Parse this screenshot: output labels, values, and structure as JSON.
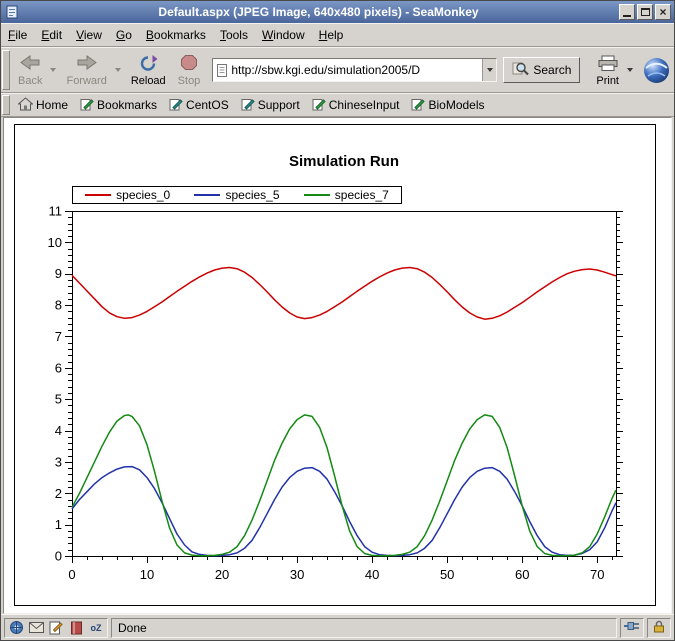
{
  "window": {
    "title": "Default.aspx (JPEG Image, 640x480 pixels) - SeaMonkey"
  },
  "menu": {
    "items": [
      "File",
      "Edit",
      "View",
      "Go",
      "Bookmarks",
      "Tools",
      "Window",
      "Help"
    ]
  },
  "toolbar": {
    "back_label": "Back",
    "forward_label": "Forward",
    "reload_label": "Reload",
    "stop_label": "Stop",
    "url_value": "http://sbw.kgi.edu/simulation2005/D",
    "search_label": "Search",
    "print_label": "Print"
  },
  "personal_bar": {
    "items": [
      "Home",
      "Bookmarks",
      "CentOS",
      "Support",
      "ChineseInput",
      "BioModels"
    ]
  },
  "status_bar": {
    "text": "Done",
    "component_icons": [
      "navigator",
      "mail-news",
      "composer",
      "address-book",
      "chatzilla"
    ],
    "chatzilla_label": "oZ",
    "right_icons": [
      "online-plug",
      "security-lock"
    ]
  },
  "chart_data": {
    "type": "line",
    "title": "Simulation Run",
    "xlabel": "",
    "ylabel": "",
    "xlim": [
      0,
      72.5
    ],
    "ylim": [
      0,
      11
    ],
    "x_major": 10,
    "x_minor": 2,
    "y_major": 1,
    "y_minor": 0.2,
    "grid": false,
    "legend_position": "top-left",
    "series": [
      {
        "name": "species_0",
        "color": "#cc0000",
        "points": [
          [
            0,
            8.95
          ],
          [
            1,
            8.7
          ],
          [
            2,
            8.45
          ],
          [
            3,
            8.2
          ],
          [
            4,
            7.95
          ],
          [
            5,
            7.75
          ],
          [
            6,
            7.63
          ],
          [
            7,
            7.58
          ],
          [
            8,
            7.6
          ],
          [
            9,
            7.68
          ],
          [
            10,
            7.8
          ],
          [
            11,
            7.95
          ],
          [
            12,
            8.1
          ],
          [
            13,
            8.27
          ],
          [
            14,
            8.44
          ],
          [
            15,
            8.6
          ],
          [
            16,
            8.76
          ],
          [
            17,
            8.9
          ],
          [
            18,
            9.02
          ],
          [
            19,
            9.12
          ],
          [
            20,
            9.18
          ],
          [
            21,
            9.2
          ],
          [
            22,
            9.16
          ],
          [
            23,
            9.05
          ],
          [
            24,
            8.88
          ],
          [
            25,
            8.66
          ],
          [
            26,
            8.42
          ],
          [
            27,
            8.17
          ],
          [
            28,
            7.94
          ],
          [
            29,
            7.75
          ],
          [
            30,
            7.62
          ],
          [
            31,
            7.57
          ],
          [
            32,
            7.6
          ],
          [
            33,
            7.68
          ],
          [
            34,
            7.8
          ],
          [
            35,
            7.95
          ],
          [
            36,
            8.1
          ],
          [
            37,
            8.27
          ],
          [
            38,
            8.44
          ],
          [
            39,
            8.6
          ],
          [
            40,
            8.76
          ],
          [
            41,
            8.9
          ],
          [
            42,
            9.02
          ],
          [
            43,
            9.12
          ],
          [
            44,
            9.18
          ],
          [
            45,
            9.2
          ],
          [
            46,
            9.16
          ],
          [
            47,
            9.05
          ],
          [
            48,
            8.88
          ],
          [
            49,
            8.66
          ],
          [
            50,
            8.42
          ],
          [
            51,
            8.17
          ],
          [
            52,
            7.94
          ],
          [
            53,
            7.75
          ],
          [
            54,
            7.62
          ],
          [
            55,
            7.55
          ],
          [
            56,
            7.58
          ],
          [
            57,
            7.66
          ],
          [
            58,
            7.78
          ],
          [
            59,
            7.93
          ],
          [
            60,
            8.08
          ],
          [
            61,
            8.25
          ],
          [
            62,
            8.42
          ],
          [
            63,
            8.58
          ],
          [
            64,
            8.74
          ],
          [
            65,
            8.88
          ],
          [
            66,
            9.0
          ],
          [
            67,
            9.08
          ],
          [
            68,
            9.13
          ],
          [
            69,
            9.15
          ],
          [
            70,
            9.12
          ],
          [
            71,
            9.05
          ],
          [
            72,
            8.97
          ],
          [
            72.5,
            8.93
          ]
        ]
      },
      {
        "name": "species_5",
        "color": "#2233aa",
        "points": [
          [
            0,
            1.5
          ],
          [
            1,
            1.8
          ],
          [
            2,
            2.05
          ],
          [
            3,
            2.3
          ],
          [
            4,
            2.5
          ],
          [
            5,
            2.65
          ],
          [
            6,
            2.77
          ],
          [
            7,
            2.84
          ],
          [
            8,
            2.85
          ],
          [
            9,
            2.75
          ],
          [
            10,
            2.5
          ],
          [
            11,
            2.15
          ],
          [
            12,
            1.7
          ],
          [
            13,
            1.2
          ],
          [
            14,
            0.7
          ],
          [
            15,
            0.35
          ],
          [
            16,
            0.13
          ],
          [
            17,
            0.05
          ],
          [
            18,
            0.02
          ],
          [
            19,
            0.01
          ],
          [
            20,
            0.02
          ],
          [
            21,
            0.04
          ],
          [
            22,
            0.1
          ],
          [
            23,
            0.25
          ],
          [
            24,
            0.5
          ],
          [
            25,
            0.9
          ],
          [
            26,
            1.35
          ],
          [
            27,
            1.8
          ],
          [
            28,
            2.2
          ],
          [
            29,
            2.5
          ],
          [
            30,
            2.7
          ],
          [
            31,
            2.8
          ],
          [
            32,
            2.82
          ],
          [
            33,
            2.7
          ],
          [
            34,
            2.45
          ],
          [
            35,
            2.05
          ],
          [
            36,
            1.6
          ],
          [
            37,
            1.1
          ],
          [
            38,
            0.65
          ],
          [
            39,
            0.3
          ],
          [
            40,
            0.12
          ],
          [
            41,
            0.04
          ],
          [
            42,
            0.02
          ],
          [
            43,
            0.01
          ],
          [
            44,
            0.02
          ],
          [
            45,
            0.04
          ],
          [
            46,
            0.1
          ],
          [
            47,
            0.25
          ],
          [
            48,
            0.5
          ],
          [
            49,
            0.9
          ],
          [
            50,
            1.35
          ],
          [
            51,
            1.8
          ],
          [
            52,
            2.2
          ],
          [
            53,
            2.5
          ],
          [
            54,
            2.7
          ],
          [
            55,
            2.8
          ],
          [
            56,
            2.82
          ],
          [
            57,
            2.7
          ],
          [
            58,
            2.45
          ],
          [
            59,
            2.05
          ],
          [
            60,
            1.6
          ],
          [
            61,
            1.1
          ],
          [
            62,
            0.65
          ],
          [
            63,
            0.3
          ],
          [
            64,
            0.12
          ],
          [
            65,
            0.04
          ],
          [
            66,
            0.02
          ],
          [
            67,
            0.03
          ],
          [
            68,
            0.08
          ],
          [
            69,
            0.2
          ],
          [
            70,
            0.45
          ],
          [
            71,
            0.9
          ],
          [
            72,
            1.45
          ],
          [
            72.5,
            1.7
          ]
        ]
      },
      {
        "name": "species_7",
        "color": "#148a14",
        "points": [
          [
            0,
            1.55
          ],
          [
            1,
            2.0
          ],
          [
            2,
            2.5
          ],
          [
            3,
            3.0
          ],
          [
            4,
            3.5
          ],
          [
            5,
            3.95
          ],
          [
            6,
            4.3
          ],
          [
            7,
            4.48
          ],
          [
            7.5,
            4.5
          ],
          [
            8,
            4.45
          ],
          [
            9,
            4.15
          ],
          [
            10,
            3.55
          ],
          [
            11,
            2.7
          ],
          [
            12,
            1.75
          ],
          [
            13,
            0.9
          ],
          [
            14,
            0.35
          ],
          [
            15,
            0.1
          ],
          [
            16,
            0.03
          ],
          [
            17,
            0.01
          ],
          [
            18,
            0.01
          ],
          [
            19,
            0.02
          ],
          [
            20,
            0.05
          ],
          [
            21,
            0.12
          ],
          [
            22,
            0.3
          ],
          [
            23,
            0.65
          ],
          [
            24,
            1.15
          ],
          [
            25,
            1.75
          ],
          [
            26,
            2.4
          ],
          [
            27,
            3.05
          ],
          [
            28,
            3.6
          ],
          [
            29,
            4.05
          ],
          [
            30,
            4.35
          ],
          [
            31,
            4.5
          ],
          [
            32,
            4.45
          ],
          [
            33,
            4.1
          ],
          [
            34,
            3.45
          ],
          [
            35,
            2.55
          ],
          [
            36,
            1.6
          ],
          [
            37,
            0.8
          ],
          [
            38,
            0.3
          ],
          [
            39,
            0.08
          ],
          [
            40,
            0.02
          ],
          [
            41,
            0.01
          ],
          [
            42,
            0.01
          ],
          [
            43,
            0.02
          ],
          [
            44,
            0.05
          ],
          [
            45,
            0.12
          ],
          [
            46,
            0.3
          ],
          [
            47,
            0.65
          ],
          [
            48,
            1.15
          ],
          [
            49,
            1.75
          ],
          [
            50,
            2.4
          ],
          [
            51,
            3.05
          ],
          [
            52,
            3.6
          ],
          [
            53,
            4.05
          ],
          [
            54,
            4.35
          ],
          [
            55,
            4.5
          ],
          [
            56,
            4.45
          ],
          [
            57,
            4.1
          ],
          [
            58,
            3.45
          ],
          [
            59,
            2.55
          ],
          [
            60,
            1.6
          ],
          [
            61,
            0.8
          ],
          [
            62,
            0.3
          ],
          [
            63,
            0.08
          ],
          [
            64,
            0.02
          ],
          [
            65,
            0.01
          ],
          [
            66,
            0.01
          ],
          [
            67,
            0.03
          ],
          [
            68,
            0.1
          ],
          [
            69,
            0.3
          ],
          [
            70,
            0.7
          ],
          [
            71,
            1.25
          ],
          [
            72,
            1.85
          ],
          [
            72.5,
            2.1
          ]
        ]
      }
    ]
  }
}
